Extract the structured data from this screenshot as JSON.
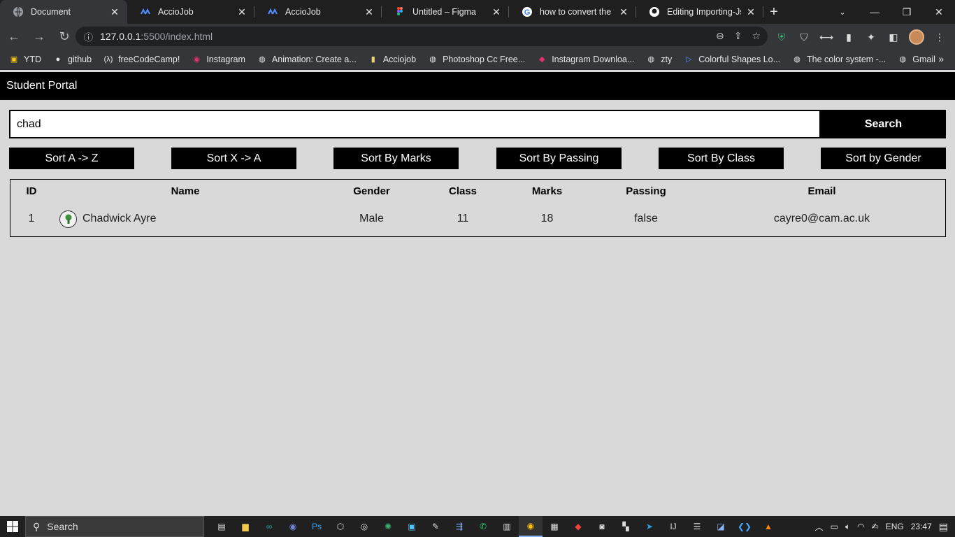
{
  "browser": {
    "tabs": [
      {
        "title": "Document",
        "icon": "globe-icon",
        "active": true
      },
      {
        "title": "AccioJob",
        "icon": "acciojob-icon"
      },
      {
        "title": "AccioJob",
        "icon": "acciojob-icon"
      },
      {
        "title": "Untitled – Figma",
        "icon": "figma-icon"
      },
      {
        "title": "how to convert the te",
        "icon": "google-icon"
      },
      {
        "title": "Editing Importing-Jso",
        "icon": "github-icon"
      }
    ],
    "url_host": "127.0.0.1",
    "url_path": ":5500/index.html",
    "bookmarks": [
      {
        "label": "YTD",
        "icon": "ytd-icon"
      },
      {
        "label": "github",
        "icon": "github-icon"
      },
      {
        "label": "freeCodeCamp!",
        "icon": "fcc-icon"
      },
      {
        "label": "Instagram",
        "icon": "instagram-icon"
      },
      {
        "label": "Animation: Create a...",
        "icon": "globe-icon"
      },
      {
        "label": "Acciojob",
        "icon": "folder-icon"
      },
      {
        "label": "Photoshop Cc Free...",
        "icon": "globe-icon"
      },
      {
        "label": "Instagram Downloa...",
        "icon": "diamond-icon"
      },
      {
        "label": "zty",
        "icon": "globe-icon"
      },
      {
        "label": "Colorful Shapes Lo...",
        "icon": "play-icon"
      },
      {
        "label": "The color system -...",
        "icon": "globe-icon"
      },
      {
        "label": "Gmail",
        "icon": "globe-icon"
      }
    ]
  },
  "app": {
    "title": "Student Portal",
    "search_value": "chad",
    "search_button": "Search",
    "sort_buttons": [
      "Sort A -> Z",
      "Sort X -> A",
      "Sort By Marks",
      "Sort By Passing",
      "Sort By Class",
      "Sort by Gender"
    ],
    "table": {
      "headers": [
        "ID",
        "Name",
        "Gender",
        "Class",
        "Marks",
        "Passing",
        "Email"
      ],
      "rows": [
        {
          "id": "1",
          "name": "Chadwick Ayre",
          "gender": "Male",
          "class": "11",
          "marks": "18",
          "passing": "false",
          "email": "cayre0@cam.ac.uk"
        }
      ]
    }
  },
  "taskbar": {
    "search_label": "Search",
    "language": "ENG",
    "time": "23:47"
  },
  "colors": {
    "accent_black": "#000000",
    "page_bg": "#d9d9d9"
  }
}
